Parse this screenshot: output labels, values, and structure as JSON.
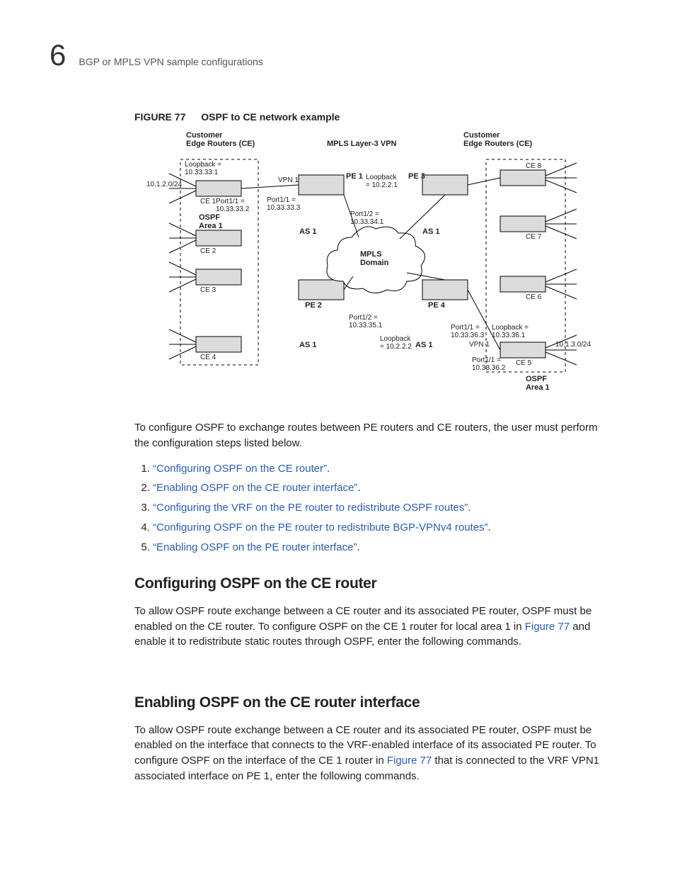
{
  "header": {
    "chapter_number": "6",
    "running_title": "BGP or MPLS VPN sample configurations"
  },
  "figure": {
    "label": "FIGURE 77",
    "caption": "OSPF to CE network example",
    "labels": {
      "ce_left_hdr": "Customer\nEdge Routers (CE)",
      "ce_right_hdr": "Customer\nEdge Routers (CE)",
      "mpls_hdr": "MPLS Layer-3 VPN",
      "loopback_l": "Loopback =\n10.33.33.1",
      "subnet_l": "10.1.2.0/24",
      "ce1": "CE 1",
      "ce1_port": "Port1/1 =\n10.33.33.2",
      "ospf_area_l": "OSPF\nArea 1",
      "ce2": "CE 2",
      "ce3": "CE 3",
      "ce4": "CE 4",
      "pe1": "PE 1",
      "vpn1_l": "VPN 1",
      "pe1_port": "Port1/1 =\n10.33.33.3",
      "pe1_lb": "Loopback\n= 10.2.2.1",
      "as1a": "AS 1",
      "pe1_p12": "Port1/2 =\n10.33.34.1",
      "mpls_dom": "MPLS\nDomain",
      "pe2": "PE 2",
      "as1b": "AS 1",
      "pe2_p12": "Port1/2 =\n10.33.35.1",
      "pe2_lb": "Loopback\n= 10.2.2.2",
      "as1c": "AS 1",
      "pe3": "PE 3",
      "as1d": "AS 1",
      "pe4": "PE 4",
      "ce5": "CE 5",
      "ce6": "CE 6",
      "ce7": "CE 7",
      "ce8": "CE 8",
      "vpn1_r": "VPN 1",
      "r_port_a": "Port1/1 =\n10.33.36.3",
      "r_lb": "Loopback =\n10.33.36.1",
      "r_port_b": "Port1/1 =\n10.33.36.2",
      "subnet_r": "10.1.3.0/24",
      "ospf_area_r": "OSPF\nArea 1"
    }
  },
  "intro": "To configure OSPF to exchange routes between PE routers and CE routers, the user must perform the configuration steps listed below.",
  "steps": [
    "“Configuring OSPF on the CE router”",
    "“Enabling OSPF on the CE router interface”",
    "“Configuring the VRF on the PE router to redistribute OSPF routes”",
    "“Configuring OSPF on the PE router to redistribute BGP-VPNv4 routes”",
    "“Enabling OSPF on the PE router interface”"
  ],
  "sect1": {
    "title": "Configuring OSPF on the CE router",
    "p_a": "To allow OSPF route exchange between a CE router and its associated PE router, OSPF must be enabled on the CE router. To configure OSPF on the CE 1 router for local area 1 in ",
    "link": "Figure 77",
    "p_b": " and enable it to redistribute static routes through OSPF, enter the following commands."
  },
  "sect2": {
    "title": "Enabling OSPF on the CE router interface",
    "p_a": "To allow OSPF route exchange between a CE router and its associated PE router, OSPF must be enabled on the interface that connects to the VRF-enabled interface of its associated PE router. To configure OSPF on the interface of the CE 1 router in ",
    "link": "Figure 77",
    "p_b": " that is connected to the VRF VPN1 associated interface on PE 1, enter the following commands."
  }
}
